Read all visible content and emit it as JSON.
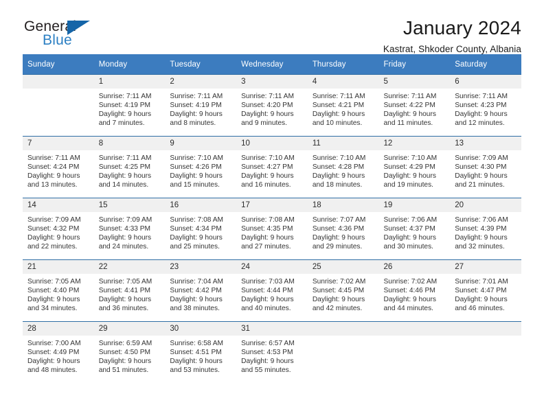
{
  "brand": {
    "name_top": "General",
    "name_bottom": "Blue",
    "accent_color": "#2b7fc3",
    "triangle_color": "#1565a8"
  },
  "header": {
    "title": "January 2024",
    "subtitle": "Kastrat, Shkoder County, Albania"
  },
  "calendar": {
    "header_bg": "#3c7cbf",
    "row_border_color": "#2e6da4",
    "daynum_bg": "#f0f0f0",
    "weekday_headers": [
      "Sunday",
      "Monday",
      "Tuesday",
      "Wednesday",
      "Thursday",
      "Friday",
      "Saturday"
    ],
    "weeks": [
      [
        {
          "day": "",
          "sunrise": "",
          "sunset": "",
          "daylight_line1": "",
          "daylight_line2": ""
        },
        {
          "day": "1",
          "sunrise": "Sunrise: 7:11 AM",
          "sunset": "Sunset: 4:19 PM",
          "daylight_line1": "Daylight: 9 hours",
          "daylight_line2": "and 7 minutes."
        },
        {
          "day": "2",
          "sunrise": "Sunrise: 7:11 AM",
          "sunset": "Sunset: 4:19 PM",
          "daylight_line1": "Daylight: 9 hours",
          "daylight_line2": "and 8 minutes."
        },
        {
          "day": "3",
          "sunrise": "Sunrise: 7:11 AM",
          "sunset": "Sunset: 4:20 PM",
          "daylight_line1": "Daylight: 9 hours",
          "daylight_line2": "and 9 minutes."
        },
        {
          "day": "4",
          "sunrise": "Sunrise: 7:11 AM",
          "sunset": "Sunset: 4:21 PM",
          "daylight_line1": "Daylight: 9 hours",
          "daylight_line2": "and 10 minutes."
        },
        {
          "day": "5",
          "sunrise": "Sunrise: 7:11 AM",
          "sunset": "Sunset: 4:22 PM",
          "daylight_line1": "Daylight: 9 hours",
          "daylight_line2": "and 11 minutes."
        },
        {
          "day": "6",
          "sunrise": "Sunrise: 7:11 AM",
          "sunset": "Sunset: 4:23 PM",
          "daylight_line1": "Daylight: 9 hours",
          "daylight_line2": "and 12 minutes."
        }
      ],
      [
        {
          "day": "7",
          "sunrise": "Sunrise: 7:11 AM",
          "sunset": "Sunset: 4:24 PM",
          "daylight_line1": "Daylight: 9 hours",
          "daylight_line2": "and 13 minutes."
        },
        {
          "day": "8",
          "sunrise": "Sunrise: 7:11 AM",
          "sunset": "Sunset: 4:25 PM",
          "daylight_line1": "Daylight: 9 hours",
          "daylight_line2": "and 14 minutes."
        },
        {
          "day": "9",
          "sunrise": "Sunrise: 7:10 AM",
          "sunset": "Sunset: 4:26 PM",
          "daylight_line1": "Daylight: 9 hours",
          "daylight_line2": "and 15 minutes."
        },
        {
          "day": "10",
          "sunrise": "Sunrise: 7:10 AM",
          "sunset": "Sunset: 4:27 PM",
          "daylight_line1": "Daylight: 9 hours",
          "daylight_line2": "and 16 minutes."
        },
        {
          "day": "11",
          "sunrise": "Sunrise: 7:10 AM",
          "sunset": "Sunset: 4:28 PM",
          "daylight_line1": "Daylight: 9 hours",
          "daylight_line2": "and 18 minutes."
        },
        {
          "day": "12",
          "sunrise": "Sunrise: 7:10 AM",
          "sunset": "Sunset: 4:29 PM",
          "daylight_line1": "Daylight: 9 hours",
          "daylight_line2": "and 19 minutes."
        },
        {
          "day": "13",
          "sunrise": "Sunrise: 7:09 AM",
          "sunset": "Sunset: 4:30 PM",
          "daylight_line1": "Daylight: 9 hours",
          "daylight_line2": "and 21 minutes."
        }
      ],
      [
        {
          "day": "14",
          "sunrise": "Sunrise: 7:09 AM",
          "sunset": "Sunset: 4:32 PM",
          "daylight_line1": "Daylight: 9 hours",
          "daylight_line2": "and 22 minutes."
        },
        {
          "day": "15",
          "sunrise": "Sunrise: 7:09 AM",
          "sunset": "Sunset: 4:33 PM",
          "daylight_line1": "Daylight: 9 hours",
          "daylight_line2": "and 24 minutes."
        },
        {
          "day": "16",
          "sunrise": "Sunrise: 7:08 AM",
          "sunset": "Sunset: 4:34 PM",
          "daylight_line1": "Daylight: 9 hours",
          "daylight_line2": "and 25 minutes."
        },
        {
          "day": "17",
          "sunrise": "Sunrise: 7:08 AM",
          "sunset": "Sunset: 4:35 PM",
          "daylight_line1": "Daylight: 9 hours",
          "daylight_line2": "and 27 minutes."
        },
        {
          "day": "18",
          "sunrise": "Sunrise: 7:07 AM",
          "sunset": "Sunset: 4:36 PM",
          "daylight_line1": "Daylight: 9 hours",
          "daylight_line2": "and 29 minutes."
        },
        {
          "day": "19",
          "sunrise": "Sunrise: 7:06 AM",
          "sunset": "Sunset: 4:37 PM",
          "daylight_line1": "Daylight: 9 hours",
          "daylight_line2": "and 30 minutes."
        },
        {
          "day": "20",
          "sunrise": "Sunrise: 7:06 AM",
          "sunset": "Sunset: 4:39 PM",
          "daylight_line1": "Daylight: 9 hours",
          "daylight_line2": "and 32 minutes."
        }
      ],
      [
        {
          "day": "21",
          "sunrise": "Sunrise: 7:05 AM",
          "sunset": "Sunset: 4:40 PM",
          "daylight_line1": "Daylight: 9 hours",
          "daylight_line2": "and 34 minutes."
        },
        {
          "day": "22",
          "sunrise": "Sunrise: 7:05 AM",
          "sunset": "Sunset: 4:41 PM",
          "daylight_line1": "Daylight: 9 hours",
          "daylight_line2": "and 36 minutes."
        },
        {
          "day": "23",
          "sunrise": "Sunrise: 7:04 AM",
          "sunset": "Sunset: 4:42 PM",
          "daylight_line1": "Daylight: 9 hours",
          "daylight_line2": "and 38 minutes."
        },
        {
          "day": "24",
          "sunrise": "Sunrise: 7:03 AM",
          "sunset": "Sunset: 4:44 PM",
          "daylight_line1": "Daylight: 9 hours",
          "daylight_line2": "and 40 minutes."
        },
        {
          "day": "25",
          "sunrise": "Sunrise: 7:02 AM",
          "sunset": "Sunset: 4:45 PM",
          "daylight_line1": "Daylight: 9 hours",
          "daylight_line2": "and 42 minutes."
        },
        {
          "day": "26",
          "sunrise": "Sunrise: 7:02 AM",
          "sunset": "Sunset: 4:46 PM",
          "daylight_line1": "Daylight: 9 hours",
          "daylight_line2": "and 44 minutes."
        },
        {
          "day": "27",
          "sunrise": "Sunrise: 7:01 AM",
          "sunset": "Sunset: 4:47 PM",
          "daylight_line1": "Daylight: 9 hours",
          "daylight_line2": "and 46 minutes."
        }
      ],
      [
        {
          "day": "28",
          "sunrise": "Sunrise: 7:00 AM",
          "sunset": "Sunset: 4:49 PM",
          "daylight_line1": "Daylight: 9 hours",
          "daylight_line2": "and 48 minutes."
        },
        {
          "day": "29",
          "sunrise": "Sunrise: 6:59 AM",
          "sunset": "Sunset: 4:50 PM",
          "daylight_line1": "Daylight: 9 hours",
          "daylight_line2": "and 51 minutes."
        },
        {
          "day": "30",
          "sunrise": "Sunrise: 6:58 AM",
          "sunset": "Sunset: 4:51 PM",
          "daylight_line1": "Daylight: 9 hours",
          "daylight_line2": "and 53 minutes."
        },
        {
          "day": "31",
          "sunrise": "Sunrise: 6:57 AM",
          "sunset": "Sunset: 4:53 PM",
          "daylight_line1": "Daylight: 9 hours",
          "daylight_line2": "and 55 minutes."
        },
        {
          "day": "",
          "sunrise": "",
          "sunset": "",
          "daylight_line1": "",
          "daylight_line2": ""
        },
        {
          "day": "",
          "sunrise": "",
          "sunset": "",
          "daylight_line1": "",
          "daylight_line2": ""
        },
        {
          "day": "",
          "sunrise": "",
          "sunset": "",
          "daylight_line1": "",
          "daylight_line2": ""
        }
      ]
    ]
  }
}
